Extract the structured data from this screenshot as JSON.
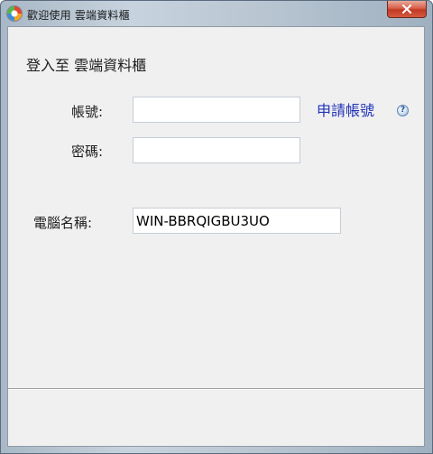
{
  "window": {
    "title": "歡迎使用 雲端資料櫃",
    "close_icon": "close-icon",
    "app_icon": "app-logo-icon"
  },
  "login": {
    "heading": "登入至 雲端資料櫃",
    "username_label": "帳號:",
    "username_value": "",
    "password_label": "密碼:",
    "password_value": "",
    "apply_link": "申請帳號",
    "help_icon": "help-icon",
    "computer_name_label": "電腦名稱:",
    "computer_name_value": "WIN-BBRQIGBU3UO"
  },
  "colors": {
    "link": "#2233b8",
    "close_button": "#c23a24",
    "client_background": "#f0f0f0"
  }
}
